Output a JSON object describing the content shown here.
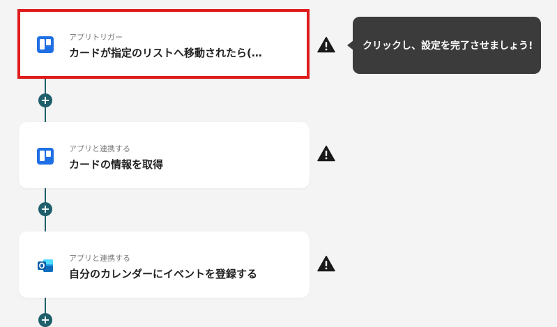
{
  "colors": {
    "accent": "#1f5f6b",
    "highlight_border": "#e01b1b",
    "tooltip_bg": "#3b3b3b",
    "trello_blue": "#1f6fe5",
    "outlook_blue": "#0f6cbd"
  },
  "flow": {
    "steps": [
      {
        "subtitle": "アプリトリガー",
        "title": "カードが指定のリストへ移動されたら(…",
        "icon": "trello-icon",
        "warning_icon": "warning-icon",
        "highlighted": true
      },
      {
        "subtitle": "アプリと連携する",
        "title": "カードの情報を取得",
        "icon": "trello-icon",
        "warning_icon": "warning-icon",
        "highlighted": false
      },
      {
        "subtitle": "アプリと連携する",
        "title": "自分のカレンダーにイベントを登録する",
        "icon": "outlook-icon",
        "warning_icon": "warning-icon",
        "highlighted": false
      }
    ],
    "add_button_symbol": "+"
  },
  "tooltip": {
    "text": "クリックし、設定を完了させましょう!"
  }
}
